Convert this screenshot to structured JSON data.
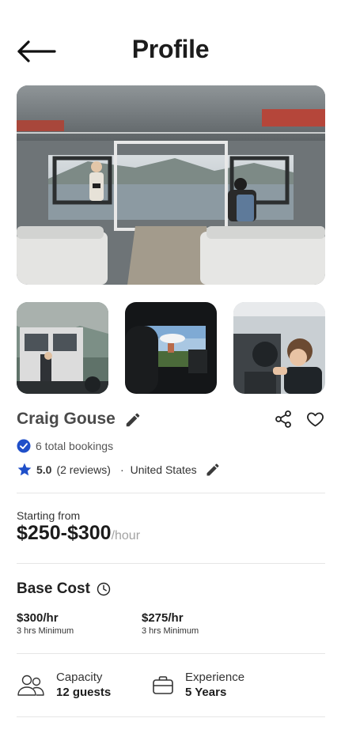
{
  "header": {
    "title": "Profile"
  },
  "profile": {
    "name": "Craig Gouse",
    "bookings": "6 total bookings",
    "rating": "5.0",
    "reviews": "(2 reviews)",
    "separator": "·",
    "location": "United States"
  },
  "pricing": {
    "starting_label": "Starting from",
    "range": "$250-$300",
    "unit": "/hour"
  },
  "base_cost": {
    "title": "Base Cost",
    "rates": [
      {
        "amount": "$300/hr",
        "minimum": "3 hrs Minimum"
      },
      {
        "amount": "$275/hr",
        "minimum": "3 hrs Minimum"
      }
    ]
  },
  "details": {
    "capacity_label": "Capacity",
    "capacity_value": "12 guests",
    "experience_label": "Experience",
    "experience_value": "5 Years"
  },
  "colors": {
    "accent": "#1f4fc9",
    "text": "#1c1c1c",
    "muted": "#a3a3a3",
    "divider": "#e6e6e6"
  }
}
